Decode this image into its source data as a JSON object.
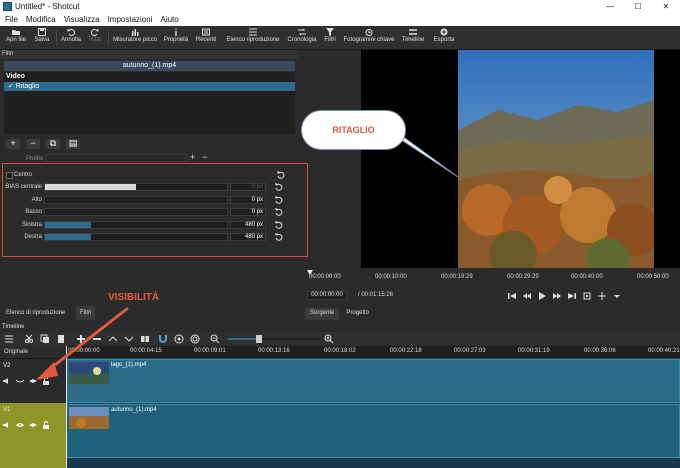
{
  "window": {
    "title": "Untitled* - Shotcut",
    "controls": [
      "—",
      "☐",
      "✕"
    ]
  },
  "menu": [
    "File",
    "Modifica",
    "Visualizza",
    "Impostazioni",
    "Aiuto"
  ],
  "toolbar": {
    "items": [
      {
        "label": "Apri file",
        "icon": "open-icon"
      },
      {
        "label": "Salva",
        "icon": "save-icon"
      },
      {
        "label": "Annulla",
        "icon": "undo-icon"
      },
      {
        "label": "Rifai",
        "icon": "redo-icon"
      },
      {
        "label": "Misuratore picco",
        "icon": "meter-icon"
      },
      {
        "label": "Proprietà",
        "icon": "info-icon"
      },
      {
        "label": "Recenti",
        "icon": "recent-icon"
      },
      {
        "label": "Elenco riproduzione",
        "icon": "playlist-icon"
      },
      {
        "label": "Cronologia",
        "icon": "history-icon"
      },
      {
        "label": "Filtri",
        "icon": "filter-icon"
      },
      {
        "label": "Fotogrammi chiave",
        "icon": "keyframe-icon"
      },
      {
        "label": "Timeline",
        "icon": "timeline-icon"
      },
      {
        "label": "Esporta",
        "icon": "export-icon"
      }
    ]
  },
  "filters": {
    "panel_title": "Filtri",
    "clip_name": "autunno_(1).mp4",
    "category": "Video",
    "selected_filter": "✓ Ritaglio",
    "preset_label": "Profilo",
    "params": [
      {
        "label": "Centro",
        "type": "checkbox"
      },
      {
        "label": "BIAS centrale",
        "value": "0 px",
        "fill": 0.5,
        "style": "white",
        "dim": true
      },
      {
        "label": "Alto",
        "value": "0 px",
        "fill": 0
      },
      {
        "label": "Basso",
        "value": "0 px",
        "fill": 0
      },
      {
        "label": "Sinistra",
        "value": "480 px",
        "fill": 0.25
      },
      {
        "label": "Destra",
        "value": "480 px",
        "fill": 0.25
      }
    ]
  },
  "bottom_tabs": [
    "Elenco di riproduzione",
    "Filtri"
  ],
  "annotations": {
    "callout": "RITAGLIO",
    "visibility": "VISIBILITÀ",
    "accent": "#e25a3b"
  },
  "viewer": {
    "ruler_ticks": [
      "00:00:00:00",
      "00:00:10:00",
      "00:00:19:29",
      "00:00:29:29",
      "00:00:40:00",
      "00:00:50:00"
    ],
    "current_time": "00:00:00:00",
    "total_time": "/ 00:01:15:26",
    "tabs": [
      "Sorgente",
      "Progetto"
    ],
    "active_tab": "Sorgente"
  },
  "timeline": {
    "label": "Timeline",
    "master_label": "Originale",
    "ruler": [
      "00:00:00:00",
      "00:00:04:15",
      "00:00:09:01",
      "00:00:13:16",
      "00:00:18:02",
      "00:00:22:18",
      "00:00:27:03",
      "00:00:31:19",
      "00:00:36:06",
      "00:00:40:21"
    ],
    "tracks": [
      {
        "name": "V2",
        "clip": "lago_(1).mp4"
      },
      {
        "name": "V1",
        "clip": "autunno_(1).mp4"
      }
    ]
  }
}
